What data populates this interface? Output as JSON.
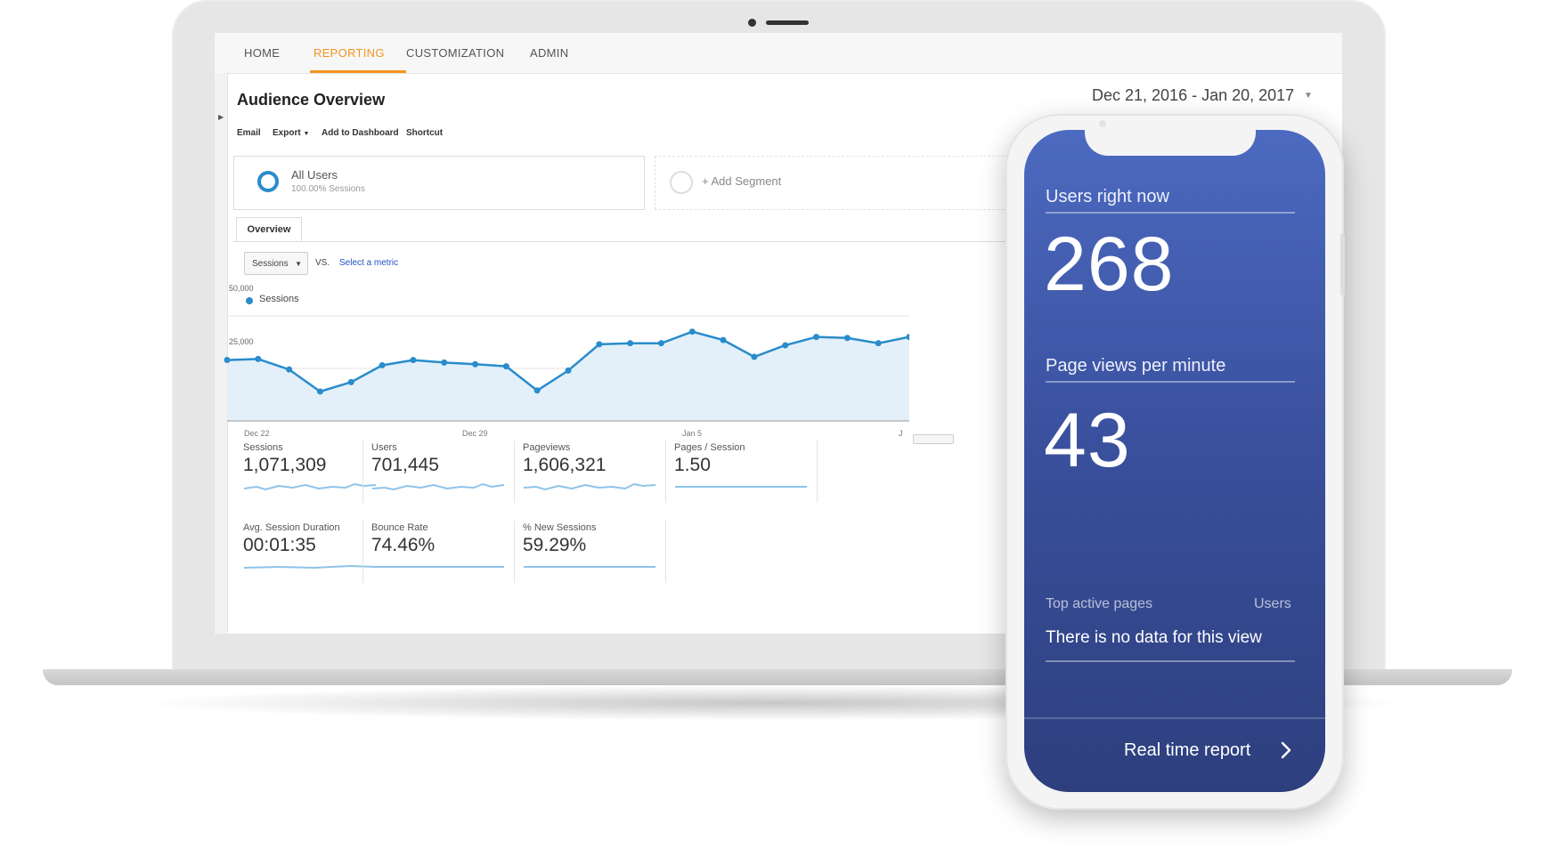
{
  "nav": {
    "home": "HOME",
    "reporting": "REPORTING",
    "customization": "CUSTOMIZATION",
    "admin": "ADMIN",
    "active_color": "#f4941f"
  },
  "report": {
    "title": "Audience Overview",
    "date_range": "Dec 21, 2016 - Jan 20, 2017"
  },
  "toolbar": {
    "email": "Email",
    "export": "Export",
    "add_to_dashboard": "Add to Dashboard",
    "shortcut": "Shortcut"
  },
  "segment": {
    "name": "All Users",
    "sub": "100.00% Sessions",
    "add_label": "+ Add Segment"
  },
  "overview_tab": "Overview",
  "metric_picker": {
    "selected": "Sessions",
    "vs": "VS.",
    "select_metric": "Select a metric"
  },
  "chart_data": {
    "type": "area",
    "series": [
      {
        "name": "Sessions",
        "color": "#2a8ccb",
        "values": [
          29000,
          29500,
          24500,
          14000,
          18500,
          26500,
          29000,
          27800,
          27000,
          26000,
          14500,
          24000,
          36500,
          37000,
          37000,
          42500,
          38500,
          30500,
          36000,
          40000,
          39500,
          37000,
          40000
        ]
      }
    ],
    "y_ticks": [
      "50,000",
      "25,000"
    ],
    "x_ticks": [
      "Dec 22",
      "Dec 29",
      "Jan 5",
      "J"
    ],
    "ylim": [
      0,
      50000
    ],
    "grid": true
  },
  "metrics": [
    {
      "label": "Sessions",
      "value": "1,071,309"
    },
    {
      "label": "Users",
      "value": "701,445"
    },
    {
      "label": "Pageviews",
      "value": "1,606,321"
    },
    {
      "label": "Pages / Session",
      "value": "1.50"
    },
    {
      "label": "Avg. Session Duration",
      "value": "00:01:35"
    },
    {
      "label": "Bounce Rate",
      "value": "74.46%"
    },
    {
      "label": "% New Sessions",
      "value": "59.29%"
    }
  ],
  "phone": {
    "users_now_label": "Users right now",
    "users_now_value": "268",
    "pageviews_label": "Page views per minute",
    "pageviews_value": "43",
    "top_pages_label": "Top active pages",
    "users_col_label": "Users",
    "no_data": "There is no data for this view",
    "realtime_link": "Real time report"
  }
}
